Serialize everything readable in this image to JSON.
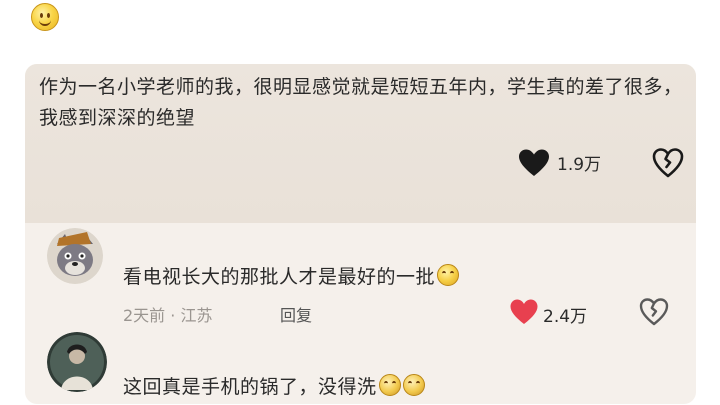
{
  "post": {
    "text": "作为一名小学老师的我，很明显感觉就是短短五年内，学生真的差了很多，我感到深深的绝望",
    "like_count": "1.9万"
  },
  "comments": [
    {
      "text": "看电视长大的那批人才是最好的一批",
      "time_location": "2天前 · 江苏",
      "reply_label": "回复",
      "like_count": "2.4万"
    },
    {
      "text": "这回真是手机的锅了，没得洗"
    }
  ],
  "colors": {
    "post_bg": "#ece5dd",
    "card_bg": "#f5f0eb",
    "like_active": "#e8404f",
    "heart_dark": "#1a1a1a"
  }
}
